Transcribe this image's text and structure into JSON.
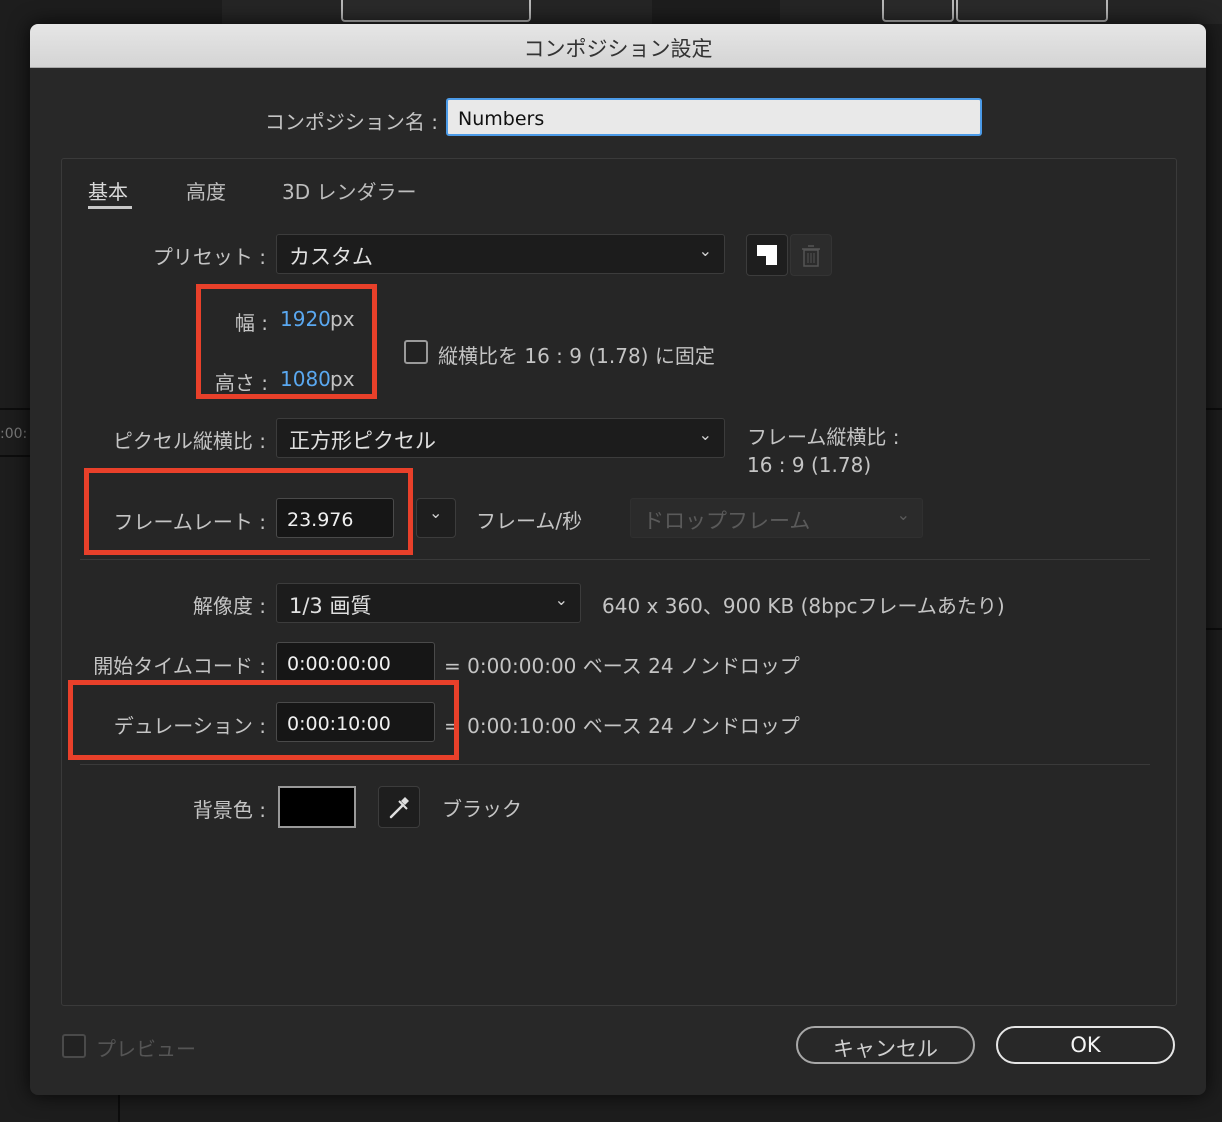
{
  "dialog": {
    "title": "コンポジション設定",
    "comp_name_label": "コンポジション名 :",
    "comp_name_value": "Numbers"
  },
  "tabs": [
    {
      "label": "基本",
      "active": true
    },
    {
      "label": "高度",
      "active": false
    },
    {
      "label": "3D レンダラー",
      "active": false
    }
  ],
  "preset": {
    "label": "プリセット :",
    "value": "カスタム"
  },
  "size": {
    "width_label": "幅 :",
    "width_value": "1920",
    "width_unit": "px",
    "height_label": "高さ :",
    "height_value": "1080",
    "height_unit": "px",
    "lock_aspect_label": "縦横比を 16 : 9 (1.78) に固定",
    "lock_aspect_checked": false
  },
  "pixel_aspect": {
    "label": "ピクセル縦横比 :",
    "value": "正方形ピクセル",
    "frame_aspect_label": "フレーム縦横比 :",
    "frame_aspect_value": "16 : 9 (1.78)"
  },
  "frame_rate": {
    "label": "フレームレート :",
    "value": "23.976",
    "unit": "フレーム/秒",
    "drop_frame": "ドロップフレーム"
  },
  "resolution": {
    "label": "解像度 :",
    "value": "1/3 画質",
    "info": "640 x 360、900 KB (8bpcフレームあたり)"
  },
  "start_timecode": {
    "label": "開始タイムコード :",
    "value": "0:00:00:00",
    "info": "= 0:00:00:00  ベース 24  ノンドロップ"
  },
  "duration": {
    "label": "デュレーション :",
    "value": "0:00:10:00",
    "info": "= 0:00:10:00  ベース 24  ノンドロップ"
  },
  "background": {
    "label": "背景色 :",
    "color": "#000000",
    "color_name": "ブラック"
  },
  "preview": {
    "label": "プレビュー",
    "checked": false
  },
  "buttons": {
    "cancel": "キャンセル",
    "ok": "OK"
  },
  "bg_app": {
    "timecode_fragment": ":00:"
  },
  "colors": {
    "accent_blue": "#5aa8f0",
    "highlight_red": "#e8402a",
    "focus_border": "#4c9be8"
  }
}
